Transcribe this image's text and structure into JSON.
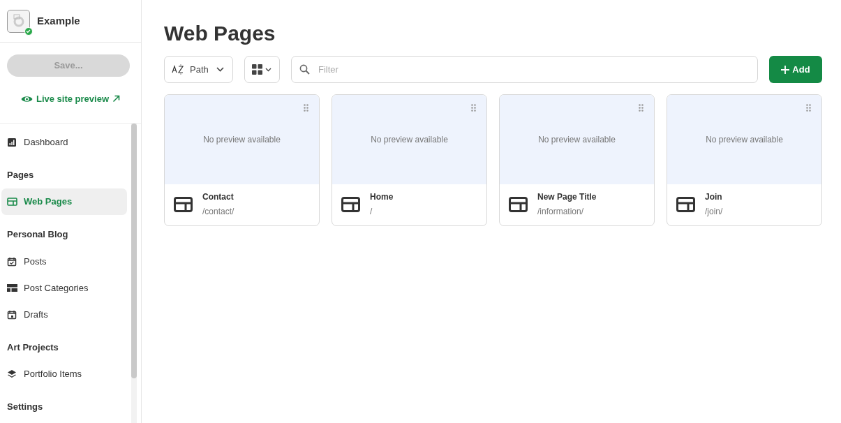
{
  "site": {
    "name": "Example",
    "published": true
  },
  "save_button": {
    "label": "Save...",
    "disabled": true
  },
  "preview_link": {
    "label": "Live site preview"
  },
  "nav": [
    {
      "items": [
        {
          "label": "Dashboard",
          "selected": false,
          "kind": "chart"
        }
      ]
    },
    {
      "heading": "Pages",
      "items": [
        {
          "label": "Web Pages",
          "selected": true,
          "kind": "layout"
        }
      ]
    },
    {
      "heading": "Personal Blog",
      "items": [
        {
          "label": "Posts",
          "selected": false,
          "kind": "calendar-check"
        },
        {
          "label": "Post Categories",
          "selected": false,
          "kind": "table"
        },
        {
          "label": "Drafts",
          "selected": false,
          "kind": "calendar"
        }
      ]
    },
    {
      "heading": "Art Projects",
      "items": [
        {
          "label": "Portfolio Items",
          "selected": false,
          "kind": "layers"
        }
      ]
    },
    {
      "heading": "Settings"
    }
  ],
  "page_title": "Web Pages",
  "sort": {
    "label": "Path"
  },
  "filter": {
    "placeholder": "Filter"
  },
  "add_button": {
    "label": "Add"
  },
  "cards": [
    {
      "preview": "No preview available",
      "title": "Contact",
      "path": "/contact/"
    },
    {
      "preview": "No preview available",
      "title": "Home",
      "path": "/"
    },
    {
      "preview": "No preview available",
      "title": "New Page Title",
      "path": "/information/"
    },
    {
      "preview": "No preview available",
      "title": "Join",
      "path": "/join/"
    }
  ]
}
